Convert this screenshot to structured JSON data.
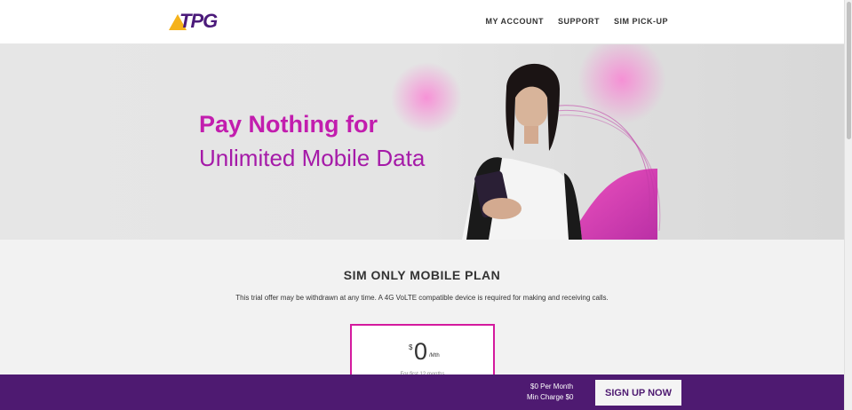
{
  "header": {
    "logo_text": "TPG",
    "nav": [
      "MY ACCOUNT",
      "SUPPORT",
      "SIM PICK-UP"
    ]
  },
  "hero": {
    "line1": "Pay Nothing for",
    "line2": "Unlimited Mobile Data"
  },
  "plan": {
    "section_title": "SIM ONLY MOBILE PLAN",
    "disclaimer": "This trial offer may be withdrawn at any time. A 4G VoLTE compatible device is required for making and receiving calls.",
    "currency": "$",
    "price": "0",
    "unit": "/Mth",
    "note": "For first 12 months"
  },
  "sticky": {
    "line1": "$0 Per Month",
    "line2": "Min Charge $0",
    "cta": "SIGN UP NOW"
  },
  "colors": {
    "brand_purple": "#4e1a71",
    "accent_magenta": "#c21dae",
    "card_border": "#d41a9e"
  }
}
